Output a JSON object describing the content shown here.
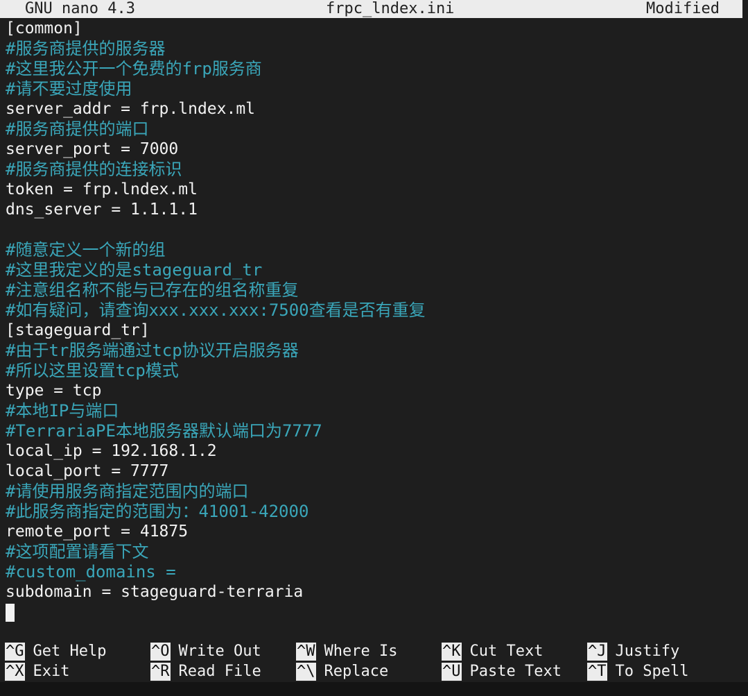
{
  "titlebar": {
    "app": "GNU nano 4.3",
    "filename": "frpc_lndex.ini",
    "status": "Modified"
  },
  "editor": {
    "lines": [
      {
        "text": "[common]",
        "kind": "code"
      },
      {
        "text": "#服务商提供的服务器",
        "kind": "comment"
      },
      {
        "text": "#这里我公开一个免费的frp服务商",
        "kind": "comment"
      },
      {
        "text": "#请不要过度使用",
        "kind": "comment"
      },
      {
        "text": "server_addr = frp.lndex.ml",
        "kind": "code"
      },
      {
        "text": "#服务商提供的端口",
        "kind": "comment"
      },
      {
        "text": "server_port = 7000",
        "kind": "code"
      },
      {
        "text": "#服务商提供的连接标识",
        "kind": "comment"
      },
      {
        "text": "token = frp.lndex.ml",
        "kind": "code"
      },
      {
        "text": "dns_server = 1.1.1.1",
        "kind": "code"
      },
      {
        "text": "",
        "kind": "code"
      },
      {
        "text": "#随意定义一个新的组",
        "kind": "comment"
      },
      {
        "text": "#这里我定义的是stageguard_tr",
        "kind": "comment"
      },
      {
        "text": "#注意组名称不能与已存在的组名称重复",
        "kind": "comment"
      },
      {
        "text": "#如有疑问，请查询xxx.xxx.xxx:7500查看是否有重复",
        "kind": "comment"
      },
      {
        "text": "[stageguard_tr]",
        "kind": "code"
      },
      {
        "text": "#由于tr服务端通过tcp协议开启服务器",
        "kind": "comment"
      },
      {
        "text": "#所以这里设置tcp模式",
        "kind": "comment"
      },
      {
        "text": "type = tcp",
        "kind": "code"
      },
      {
        "text": "#本地IP与端口",
        "kind": "comment"
      },
      {
        "text": "#TerrariaPE本地服务器默认端口为7777",
        "kind": "comment"
      },
      {
        "text": "local_ip = 192.168.1.2",
        "kind": "code"
      },
      {
        "text": "local_port = 7777",
        "kind": "code"
      },
      {
        "text": "#请使用服务商指定范围内的端口",
        "kind": "comment"
      },
      {
        "text": "#此服务商指定的范围为：41001-42000",
        "kind": "comment"
      },
      {
        "text": "remote_port = 41875",
        "kind": "code"
      },
      {
        "text": "#这项配置请看下文",
        "kind": "comment"
      },
      {
        "text": "#custom_domains =",
        "kind": "comment"
      },
      {
        "text": "subdomain = stageguard-terraria",
        "kind": "code"
      }
    ]
  },
  "shortcuts": {
    "row1": [
      {
        "key": "^G",
        "label": "Get Help"
      },
      {
        "key": "^O",
        "label": "Write Out"
      },
      {
        "key": "^W",
        "label": "Where Is"
      },
      {
        "key": "^K",
        "label": "Cut Text"
      },
      {
        "key": "^J",
        "label": "Justify"
      }
    ],
    "row2": [
      {
        "key": "^X",
        "label": "Exit"
      },
      {
        "key": "^R",
        "label": "Read File"
      },
      {
        "key": "^\\",
        "label": "Replace"
      },
      {
        "key": "^U",
        "label": "Paste Text"
      },
      {
        "key": "^T",
        "label": "To Spell"
      }
    ]
  },
  "colors": {
    "comment": "#3aa6b9",
    "text": "#f2f2f2",
    "background": "#1e1e1e",
    "bar": "#ececec"
  }
}
